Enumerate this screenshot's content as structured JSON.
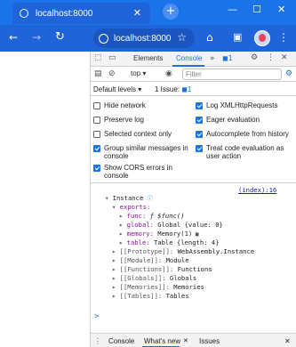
{
  "browser": {
    "tab_title": "localhost:8000",
    "url": "localhost:8000",
    "accent": "#1a73e8"
  },
  "devtools": {
    "tabs": [
      "Elements",
      "Console"
    ],
    "more_chevron": "»",
    "issues_badge": "1",
    "context": "top",
    "filter_placeholder": "Filter",
    "levels": "Default levels",
    "issues_text": "1 Issue:",
    "issues_count": "1"
  },
  "settings": {
    "left": [
      {
        "label": "Hide network",
        "checked": false
      },
      {
        "label": "Preserve log",
        "checked": false
      },
      {
        "label": "Selected context only",
        "checked": false
      },
      {
        "label": "Group similar messages in console",
        "checked": true
      },
      {
        "label": "Show CORS errors in console",
        "checked": true
      }
    ],
    "right": [
      {
        "label": "Log XMLHttpRequests",
        "checked": true
      },
      {
        "label": "Eager evaluation",
        "checked": true
      },
      {
        "label": "Autocomplete from history",
        "checked": true
      },
      {
        "label": "Treat code evaluation as user action",
        "checked": true
      }
    ]
  },
  "console": {
    "source_link": "(index):16",
    "instance_label": "Instance",
    "exports_label": "exports:",
    "func_key": "func:",
    "func_val": "ƒ $func()",
    "global_key": "global:",
    "global_val": "Global {value: 0}",
    "memory_key": "memory:",
    "memory_val": "Memory(1)",
    "table_key": "table:",
    "table_val": "Table {length: 4}",
    "internals": [
      {
        "key": "[[Prototype]]:",
        "val": "WebAssembly.Instance"
      },
      {
        "key": "[[Module]]:",
        "val": "Module"
      },
      {
        "key": "[[Functions]]:",
        "val": "Functions"
      },
      {
        "key": "[[Globals]]:",
        "val": "Globals"
      },
      {
        "key": "[[Memories]]:",
        "val": "Memories"
      },
      {
        "key": "[[Tables]]:",
        "val": "Tables"
      }
    ],
    "prompt": ">"
  },
  "drawer": {
    "tabs": [
      "Console",
      "What's new",
      "Issues"
    ]
  }
}
